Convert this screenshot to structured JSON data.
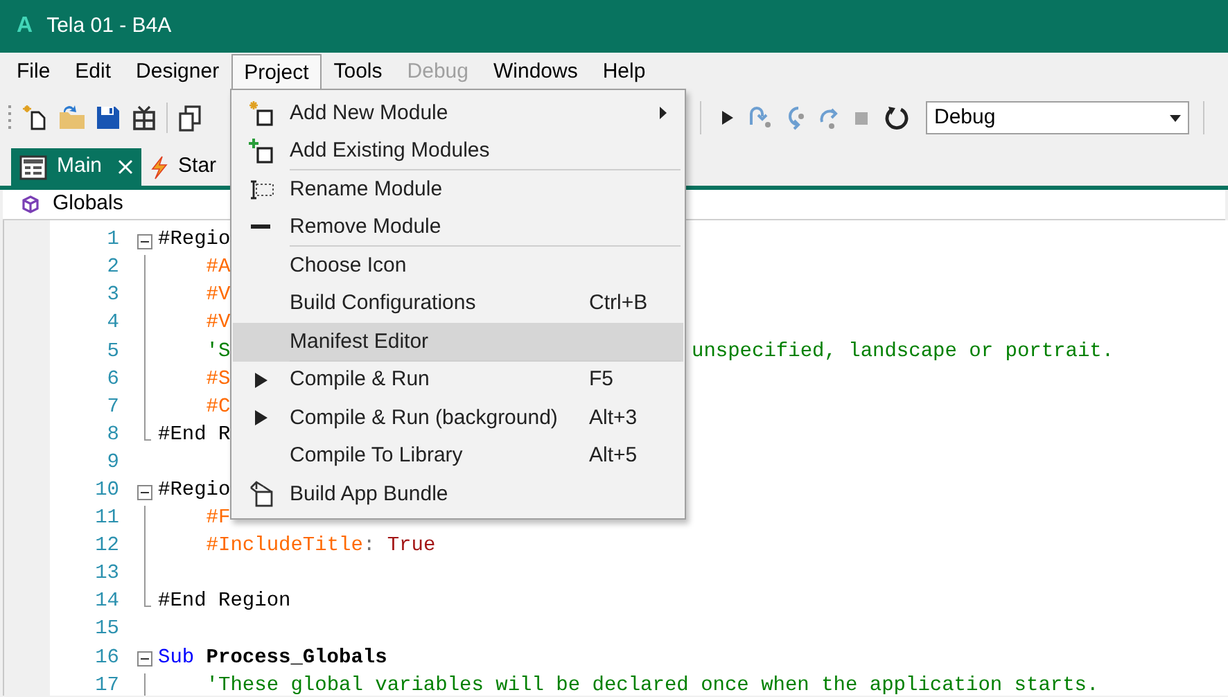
{
  "window": {
    "app_icon_letter": "A",
    "title": "Tela 01 - B4A"
  },
  "menu_bar": [
    {
      "label": "File",
      "selected": false,
      "disabled": false
    },
    {
      "label": "Edit",
      "selected": false,
      "disabled": false
    },
    {
      "label": "Designer",
      "selected": false,
      "disabled": false
    },
    {
      "label": "Project",
      "selected": true,
      "disabled": false
    },
    {
      "label": "Tools",
      "selected": false,
      "disabled": false
    },
    {
      "label": "Debug",
      "selected": false,
      "disabled": true
    },
    {
      "label": "Windows",
      "selected": false,
      "disabled": false
    },
    {
      "label": "Help",
      "selected": false,
      "disabled": false
    }
  ],
  "toolbar": {
    "build_config": "Debug"
  },
  "tabs": [
    {
      "label": "Main",
      "selected": true
    },
    {
      "label": "Star",
      "selected": false
    }
  ],
  "breadcrumb": "Globals",
  "code_lines": [
    {
      "number": "1",
      "kind": "fold_start",
      "parts": [
        {
          "kind": "plain",
          "text": "#Regio"
        }
      ]
    },
    {
      "number": "2",
      "kind": "folded",
      "parts": [
        {
          "kind": "directive",
          "text": "    #A"
        }
      ]
    },
    {
      "number": "3",
      "kind": "folded",
      "parts": [
        {
          "kind": "directive",
          "text": "    #V"
        }
      ]
    },
    {
      "number": "4",
      "kind": "folded",
      "parts": [
        {
          "kind": "directive",
          "text": "    #V"
        }
      ]
    },
    {
      "number": "5",
      "kind": "folded",
      "parts": [
        {
          "kind": "comment",
          "text": "    'S"
        }
      ],
      "right_parts": [
        {
          "kind": "comment",
          "text": "unspecified, landscape or portrait."
        }
      ]
    },
    {
      "number": "6",
      "kind": "folded",
      "parts": [
        {
          "kind": "directive",
          "text": "    #S"
        }
      ]
    },
    {
      "number": "7",
      "kind": "folded",
      "parts": [
        {
          "kind": "directive",
          "text": "    #C"
        }
      ]
    },
    {
      "number": "8",
      "kind": "fold_end",
      "parts": [
        {
          "kind": "plain",
          "text": "#End R"
        }
      ]
    },
    {
      "number": "9",
      "kind": "plain"
    },
    {
      "number": "10",
      "kind": "fold_start",
      "parts": [
        {
          "kind": "plain",
          "text": "#Regio"
        }
      ]
    },
    {
      "number": "11",
      "kind": "folded",
      "parts": [
        {
          "kind": "directive",
          "text": "    #F"
        }
      ]
    },
    {
      "number": "12",
      "kind": "folded",
      "parts": [
        {
          "kind": "directive",
          "text": "    #IncludeTitle"
        },
        {
          "kind": "punct",
          "text": ": "
        },
        {
          "kind": "value",
          "text": "True"
        }
      ]
    },
    {
      "number": "13",
      "kind": "folded"
    },
    {
      "number": "14",
      "kind": "fold_end",
      "parts": [
        {
          "kind": "plain",
          "text": "#End Region"
        }
      ]
    },
    {
      "number": "15",
      "kind": "plain"
    },
    {
      "number": "16",
      "kind": "fold_start",
      "parts": [
        {
          "kind": "keyword",
          "text": "Sub"
        },
        {
          "kind": "name",
          "text": "Process_Globals"
        }
      ]
    },
    {
      "number": "17",
      "kind": "folded",
      "parts": [
        {
          "kind": "comment",
          "text": "    'These global variables will be declared once when the application starts."
        }
      ]
    }
  ],
  "project_menu": [
    {
      "label": "Add New Module",
      "submenu": true,
      "selected": false,
      "separator_after": false
    },
    {
      "label": "Add Existing Modules",
      "submenu": false,
      "selected": false,
      "separator_after": true
    },
    {
      "label": "Rename Module",
      "submenu": false,
      "selected": false,
      "separator_after": false
    },
    {
      "label": "Remove Module",
      "submenu": false,
      "selected": false,
      "separator_after": true
    },
    {
      "label": "Choose Icon",
      "submenu": false,
      "selected": false,
      "separator_after": false
    },
    {
      "label": "Build Configurations",
      "shortcut": "Ctrl+B",
      "submenu": false,
      "selected": false,
      "separator_after": false
    },
    {
      "label": "Manifest Editor",
      "submenu": false,
      "selected": true,
      "separator_after": true
    },
    {
      "label": "Compile & Run",
      "shortcut": "F5",
      "submenu": false,
      "selected": false,
      "separator_after": false
    },
    {
      "label": "Compile & Run (background)",
      "shortcut": "Alt+3",
      "submenu": false,
      "selected": false,
      "separator_after": false
    },
    {
      "label": "Compile To Library",
      "shortcut": "Alt+5",
      "submenu": false,
      "selected": false,
      "separator_after": false
    },
    {
      "label": "Build App Bundle",
      "submenu": false,
      "selected": false,
      "separator_after": false
    }
  ]
}
